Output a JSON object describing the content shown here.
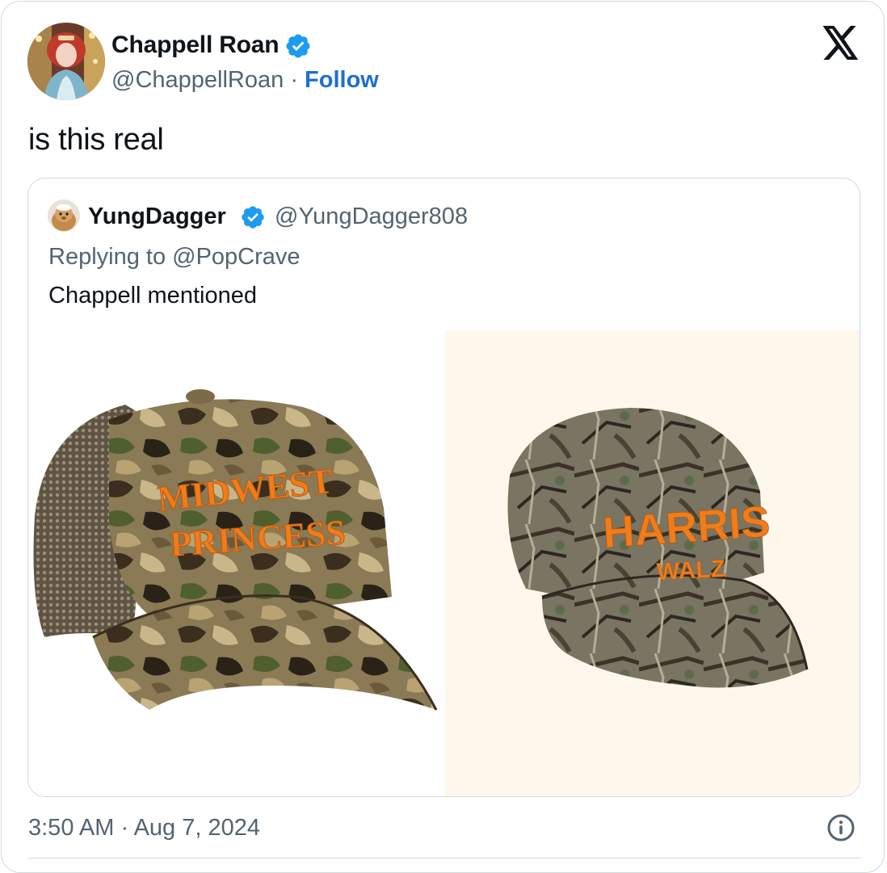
{
  "tweet": {
    "author": {
      "display_name": "Chappell Roan",
      "handle": "@ChappellRoan",
      "verified": true
    },
    "separator": "·",
    "follow_label": "Follow",
    "text": "is this real",
    "timestamp": "3:50 AM · Aug 7, 2024"
  },
  "quoted_tweet": {
    "author": {
      "display_name": "YungDagger",
      "handle": "@YungDagger808",
      "verified": true
    },
    "replying_to": "Replying to @PopCrave",
    "text": "Chappell mentioned",
    "images": [
      {
        "cap_text_line1": "MIDWEST",
        "cap_text_line2": "PRINCESS"
      },
      {
        "cap_text_line1": "HARRIS",
        "cap_text_line2": "WALZ"
      }
    ]
  },
  "icons": {
    "verified": "verified-badge-icon",
    "brand": "x-logo-icon",
    "info": "info-icon"
  },
  "colors": {
    "link": "#1d6fd0",
    "verified": "#1d9bf0",
    "secondary_text": "#536471",
    "border": "#cfd9de",
    "cap_embroidery": "#f07c1a"
  }
}
